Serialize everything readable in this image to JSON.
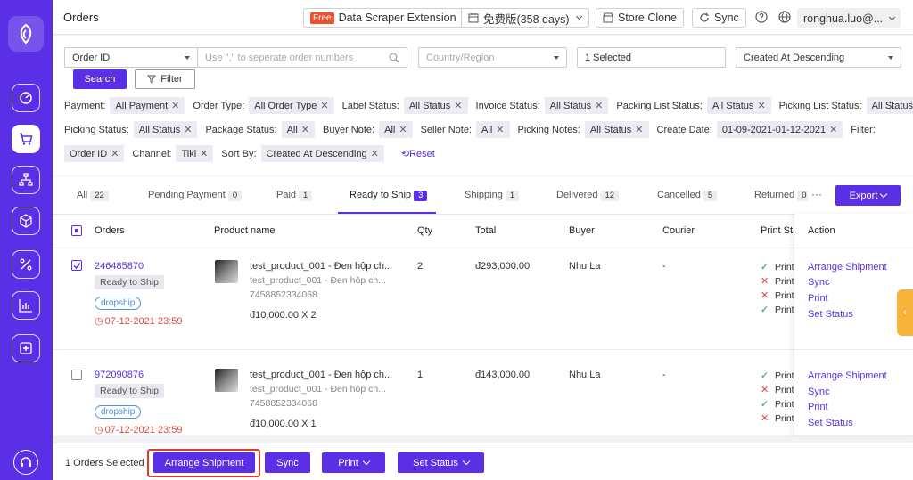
{
  "header": {
    "title": "Orders",
    "free_badge": "Free",
    "scraper_label": "Data Scraper Extension",
    "plan_label": "免费版(358 days)",
    "store_clone_label": "Store Clone",
    "sync_label": "Sync",
    "user_label": "ronghua.luo@..."
  },
  "filters": {
    "order_id_select": "Order ID",
    "order_numbers_placeholder": "Use \",\" to seperate order numbers",
    "country_placeholder": "Country/Region",
    "selected_label": "1 Selected",
    "sort_select": "Created At Descending",
    "search_label": "Search",
    "filter_label": "Filter",
    "row1": [
      {
        "label": "Payment:",
        "value": "All Payment"
      },
      {
        "label": "Order Type:",
        "value": "All Order Type"
      },
      {
        "label": "Label Status:",
        "value": "All Status"
      },
      {
        "label": "Invoice Status:",
        "value": "All Status"
      },
      {
        "label": "Packing List Status:",
        "value": "All Status"
      },
      {
        "label": "Picking List Status:",
        "value": "All Status"
      }
    ],
    "row2": [
      {
        "label": "Picking Status:",
        "value": "All Status"
      },
      {
        "label": "Package Status:",
        "value": "All"
      },
      {
        "label": "Buyer Note:",
        "value": "All"
      },
      {
        "label": "Seller Note:",
        "value": "All"
      },
      {
        "label": "Picking Notes:",
        "value": "All Status"
      },
      {
        "label": "Create Date:",
        "value": "01-09-2021-01-12-2021"
      }
    ],
    "row2_tail_label": "Filter:",
    "row3": [
      {
        "label": "",
        "value": "Order ID"
      },
      {
        "label": "Channel:",
        "value": "Tiki"
      },
      {
        "label": "Sort By:",
        "value": "Created At Descending"
      }
    ],
    "reset_label": "Reset"
  },
  "tabs": [
    {
      "label": "All",
      "count": "22"
    },
    {
      "label": "Pending Payment",
      "count": "0"
    },
    {
      "label": "Paid",
      "count": "1"
    },
    {
      "label": "Ready to Ship",
      "count": "3"
    },
    {
      "label": "Shipping",
      "count": "1"
    },
    {
      "label": "Delivered",
      "count": "12"
    },
    {
      "label": "Cancelled",
      "count": "5"
    },
    {
      "label": "Returned",
      "count": "0"
    }
  ],
  "toolbar": {
    "more": "···",
    "export_label": "Export"
  },
  "columns": [
    "Orders",
    "Product name",
    "Qty",
    "Total",
    "Buyer",
    "Courier",
    "Print Sta",
    "Action"
  ],
  "orders": [
    {
      "id": "246485870",
      "status": "Ready to Ship",
      "badge": "dropship",
      "deadline": "07-12-2021 23:59",
      "product_name": "test_product_001 - Đen hộp ch...",
      "product_variant": "test_product_001 - Đen hộp ch...",
      "sku": "7458852334068",
      "price_line": "đ10,000.00 X 2",
      "qty": "2",
      "total": "đ293,000.00",
      "buyer": "Nhu La",
      "courier": "-",
      "print": [
        {
          "ok": true,
          "label": "Print"
        },
        {
          "ok": false,
          "label": "Print"
        },
        {
          "ok": false,
          "label": "Print"
        },
        {
          "ok": true,
          "label": "Print"
        }
      ]
    },
    {
      "id": "972090876",
      "status": "Ready to Ship",
      "badge": "dropship",
      "deadline": "07-12-2021 23:59",
      "product_name": "test_product_001 - Đen hộp ch...",
      "product_variant": "test_product_001 - Đen hộp ch...",
      "sku": "7458852334068",
      "price_line": "đ10,000.00 X 1",
      "qty": "1",
      "total": "đ143,000.00",
      "buyer": "Nhu La",
      "courier": "-",
      "print": [
        {
          "ok": true,
          "label": "Print"
        },
        {
          "ok": false,
          "label": "Print"
        },
        {
          "ok": true,
          "label": "Print"
        },
        {
          "ok": false,
          "label": "Print"
        }
      ]
    }
  ],
  "actions": [
    "Arrange Shipment",
    "Sync",
    "Print",
    "Set Status"
  ],
  "bottom": {
    "selected_text": "1 Orders Selected",
    "arrange_label": "Arrange Shipment",
    "sync_label": "Sync",
    "print_label": "Print",
    "set_status_label": "Set Status"
  },
  "colors": {
    "accent": "#5b2fe6",
    "highlight": "#e0392f",
    "deadline": "#e24b3b"
  }
}
